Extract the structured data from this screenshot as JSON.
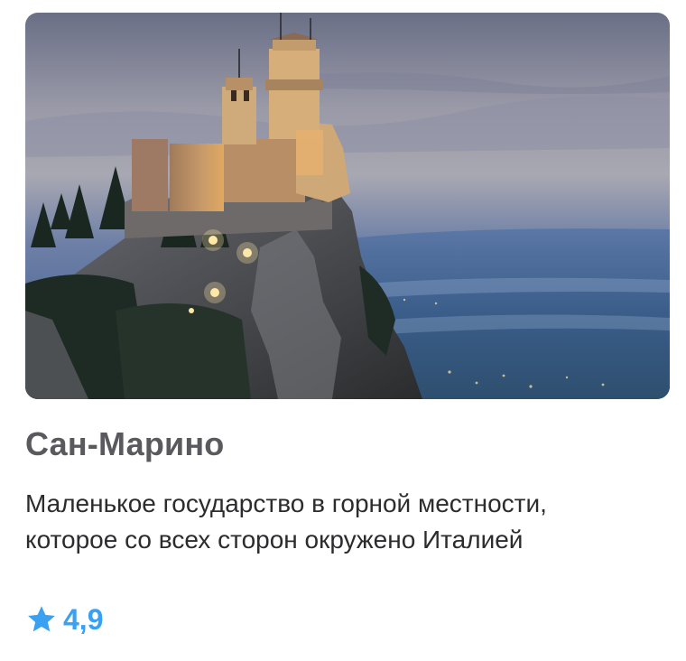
{
  "card": {
    "title": "Сан-Марино",
    "description_lines": [
      "Маленькое государство в горной местности,",
      "которое со всех сторон окружено Италией"
    ],
    "rating": {
      "value": "4,9",
      "icon": "star-icon"
    },
    "image": {
      "subject": "castle-on-cliff-photo"
    }
  },
  "colors": {
    "title": "#5a5a5e",
    "description": "#2c2c2e",
    "accent": "#3aa0f2"
  }
}
